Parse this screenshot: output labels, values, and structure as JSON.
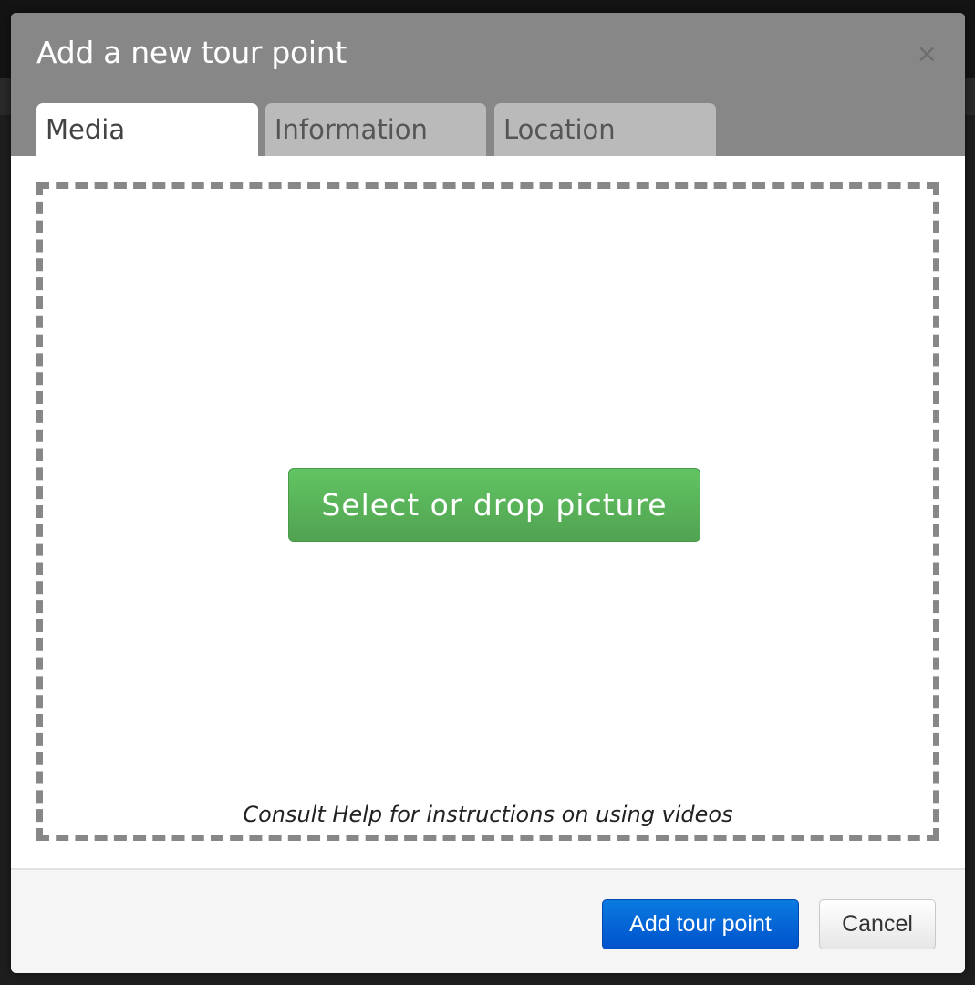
{
  "dialog": {
    "title": "Add a new tour point",
    "close_icon": "×"
  },
  "tabs": [
    {
      "label": "Media",
      "active": true
    },
    {
      "label": "Information",
      "active": false
    },
    {
      "label": "Location",
      "active": false
    }
  ],
  "media": {
    "select_button": "Select or drop picture",
    "hint": "Consult Help for instructions on using videos"
  },
  "footer": {
    "primary_label": "Add tour point",
    "cancel_label": "Cancel"
  },
  "colors": {
    "header": "#878787",
    "select_button": "#5cb85c",
    "primary_button": "#0066dd"
  }
}
